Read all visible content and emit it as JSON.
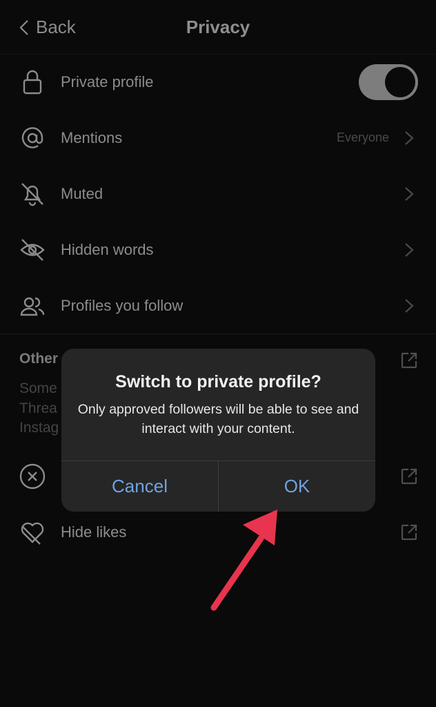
{
  "header": {
    "back_label": "Back",
    "title": "Privacy"
  },
  "settings": [
    {
      "label": "Private profile",
      "icon": "lock-icon",
      "toggle_on": true
    },
    {
      "label": "Mentions",
      "icon": "at-icon",
      "value": "Everyone"
    },
    {
      "label": "Muted",
      "icon": "bell-off-icon"
    },
    {
      "label": "Hidden words",
      "icon": "eye-off-icon"
    },
    {
      "label": "Profiles you follow",
      "icon": "people-icon"
    }
  ],
  "other": {
    "heading": "Other",
    "desc_lines": [
      "Some",
      "Threa",
      "Instag"
    ],
    "items": [
      {
        "label": "",
        "icon": "x-circle-icon"
      },
      {
        "label": "Hide likes",
        "icon": "heart-off-icon"
      }
    ]
  },
  "dialog": {
    "title": "Switch to private profile?",
    "message": "Only approved followers will be able to see and interact with your content.",
    "cancel": "Cancel",
    "ok": "OK"
  },
  "colors": {
    "accent": "#6fa3e0",
    "arrow": "#e8344e"
  }
}
